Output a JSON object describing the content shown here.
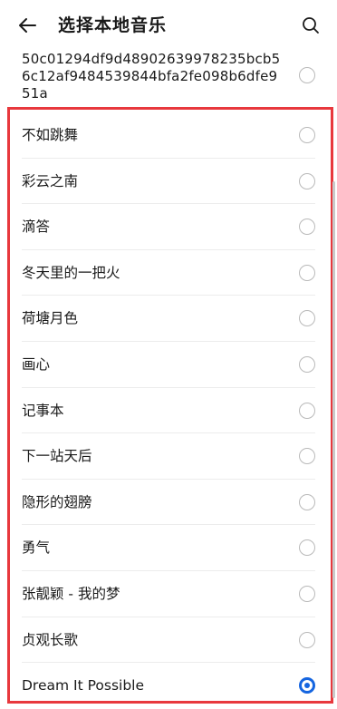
{
  "header": {
    "title": "选择本地音乐"
  },
  "top_item": {
    "label": "50c01294df9d48902639978235bcb56c12af9484539844bfa2fe098b6dfe951a"
  },
  "songs": [
    {
      "label": "不如跳舞",
      "checked": false
    },
    {
      "label": "彩云之南",
      "checked": false
    },
    {
      "label": "滴答",
      "checked": false
    },
    {
      "label": "冬天里的一把火",
      "checked": false
    },
    {
      "label": "荷塘月色",
      "checked": false
    },
    {
      "label": "画心",
      "checked": false
    },
    {
      "label": "记事本",
      "checked": false
    },
    {
      "label": "下一站天后",
      "checked": false
    },
    {
      "label": "隐形的翅膀",
      "checked": false
    },
    {
      "label": "勇气",
      "checked": false
    },
    {
      "label": "张靓颖 - 我的梦",
      "checked": false
    },
    {
      "label": "贞观长歌",
      "checked": false
    },
    {
      "label": "Dream It Possible",
      "checked": true
    }
  ],
  "colors": {
    "accent": "#1565e0",
    "highlight": "#e8383d"
  },
  "icons": {
    "back": "arrow-left-icon",
    "search": "search-icon"
  }
}
